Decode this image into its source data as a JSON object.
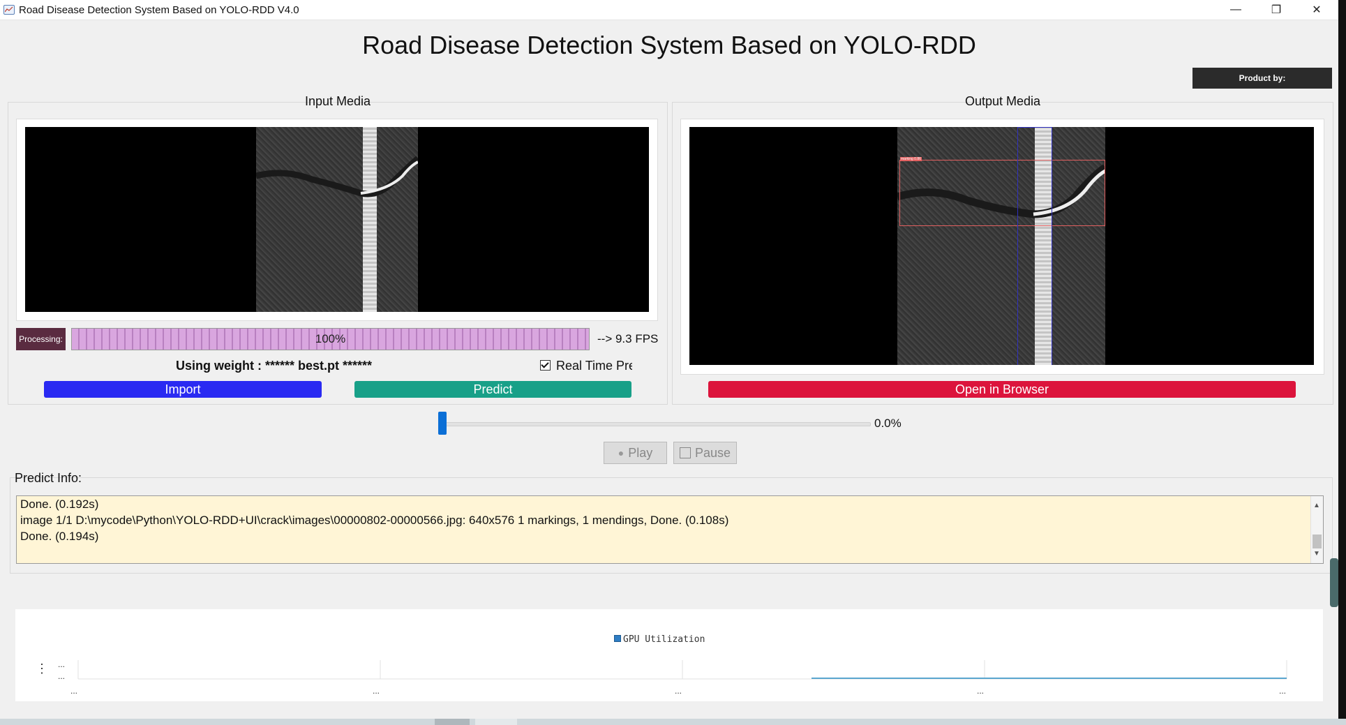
{
  "window": {
    "title": "Road Disease Detection System Based on YOLO-RDD V4.0",
    "minimize_glyph": "—",
    "maximize_glyph": "❐",
    "close_glyph": "✕"
  },
  "header": {
    "title": "Road Disease Detection System Based on YOLO-RDD",
    "product_label": "Product by:"
  },
  "input_panel": {
    "title": "Input Media",
    "processing_label": "Processing:",
    "progress": 1.0,
    "progress_text": "100%",
    "fps_text": "--> 9.3 FPS",
    "weight_text": "Using weight : ****** best.pt ******",
    "realtime_label": "Real Time Pre",
    "realtime_checked": true,
    "import_label": "Import",
    "predict_label": "Predict"
  },
  "output_panel": {
    "title": "Output Media",
    "detection_label": "marking 0.86",
    "open_browser_label": "Open in Browser"
  },
  "playback": {
    "slider_value": 0.0,
    "slider_text": "0.0%",
    "play_label": "Play",
    "pause_label": "Pause"
  },
  "predict_info": {
    "label": "Predict Info:",
    "lines": [
      "Done. (0.192s)",
      "image 1/1 D:\\mycode\\Python\\YOLO-RDD+UI\\crack\\images\\00000802-00000566.jpg: 640x576 1 markings, 1 mendings, Done. (0.108s)",
      "Done. (0.194s)"
    ]
  },
  "gpu_chart": {
    "legend": "GPU Utilization",
    "tick_text": "...",
    "side_text": "⋮"
  },
  "colors": {
    "import": "#2a2af2",
    "predict": "#18a088",
    "open_browser": "#dc143c",
    "progress_fill": "#d9a6df",
    "log_background": "#fff5d6"
  }
}
